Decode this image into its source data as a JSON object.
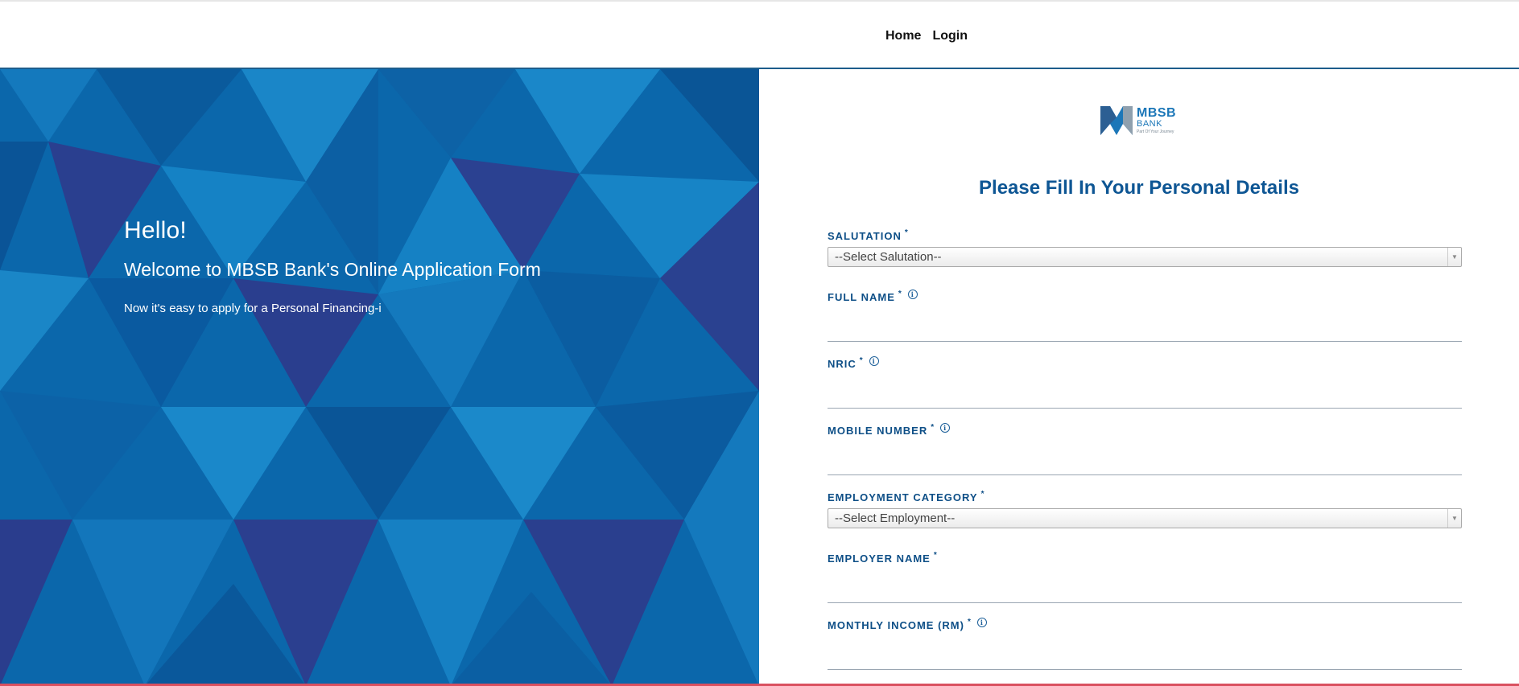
{
  "nav": {
    "items": [
      "Home",
      "Login"
    ]
  },
  "hero": {
    "hello": "Hello!",
    "welcome": "Welcome to MBSB Bank's Online Application Form",
    "sub": "Now it's easy to apply for a Personal Financing-i"
  },
  "logo": {
    "name": "MBSB",
    "sub": "BANK",
    "tagline": "Part Of Your Journey"
  },
  "form": {
    "title": "Please Fill In Your Personal Details",
    "required_mark": "*",
    "salutation": {
      "label": "SALUTATION",
      "selected": "--Select Salutation--"
    },
    "full_name": {
      "label": "FULL NAME",
      "value": ""
    },
    "nric": {
      "label": "NRIC",
      "value": ""
    },
    "mobile": {
      "label": "MOBILE NUMBER",
      "value": ""
    },
    "employment": {
      "label": "EMPLOYMENT CATEGORY",
      "selected": "--Select Employment--"
    },
    "employer": {
      "label": "EMPLOYER NAME",
      "value": ""
    },
    "income": {
      "label": "MONTHLY INCOME (RM)",
      "value": ""
    }
  },
  "icons": {
    "info": "info-circle-icon",
    "dropdown": "chevron-down-icon"
  },
  "colors": {
    "brand_blue": "#0e5694",
    "hero_blue": "#0b67ab",
    "label_blue": "#0e4f87"
  }
}
